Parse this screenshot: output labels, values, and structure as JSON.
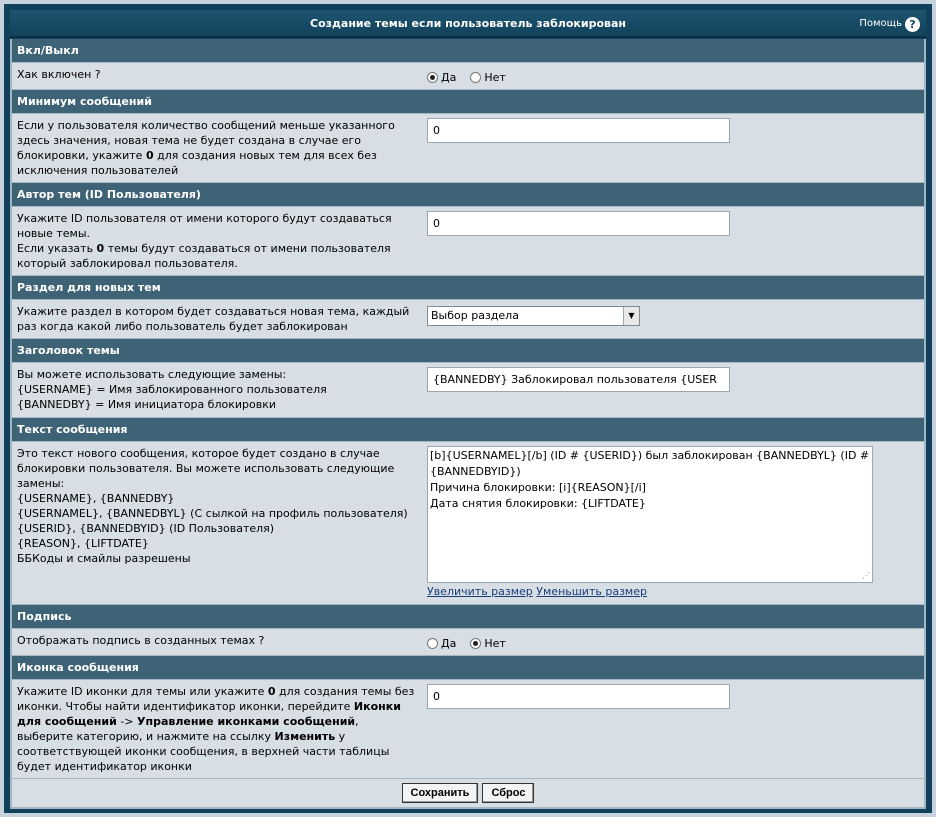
{
  "window": {
    "title": "Создание темы если пользователь заблокирован",
    "help_label": "Помощь",
    "help_icon": "?"
  },
  "sections": {
    "enable": {
      "header": "Вкл/Выкл",
      "label": "Хак включен ?",
      "options": [
        "Да",
        "Нет"
      ],
      "selected": "Да"
    },
    "min_posts": {
      "header": "Минимум сообщений",
      "label_a": "Если у пользователя количество сообщений меньше указанного здесь значения, новая тема не будет создана в случае его блокировки, укажите ",
      "label_b": "0",
      "label_c": " для создания новых тем для всех без исключения пользователей",
      "value": "0"
    },
    "author": {
      "header": "Автор тем (ID Пользователя)",
      "label_a": "Укажите ID пользователя от имени которого будут создаваться новые темы.",
      "label_b": "Если указать ",
      "label_c": "0",
      "label_d": " темы будут создаваться от имени пользователя который заблокировал пользователя.",
      "value": "0"
    },
    "forum": {
      "header": "Раздел для новых тем",
      "label": "Укажите раздел в котором будет создаваться новая тема, каждый раз когда какой либо пользователь будет заблокирован",
      "selected": "Выбор раздела"
    },
    "subject": {
      "header": "Заголовок темы",
      "label_a": "Вы можете использовать следующие замены:",
      "label_b": "{USERNAME} = Имя заблокированного пользователя",
      "label_c": "{BANNEDBY} = Имя инициатора блокировки",
      "value": "{BANNEDBY} Заблокировал пользователя {USER"
    },
    "message": {
      "header": "Текст сообщения",
      "label_lines": [
        "Это текст нового сообщения, которое будет создано в случае блокировки пользователя. Вы можете использовать следующие замены:",
        "{USERNAME}, {BANNEDBY}",
        "{USERNAMEL}, {BANNEDBYL} (С сылкой на профиль пользователя)",
        "{USERID}, {BANNEDBYID} (ID Пользователя)",
        "{REASON}, {LIFTDATE}",
        "ББКоды и смайлы разрешены"
      ],
      "value": "[b]{USERNAMEL}[/b] (ID # {USERID}) был заблокирован {BANNEDBYL} (ID # {BANNEDBYID})\nПричина блокировки: [i]{REASON}[/i]\nДата снятия блокировки: {LIFTDATE}",
      "enlarge_link": "Увеличить размер",
      "shrink_link": "Уменьшить размер"
    },
    "signature": {
      "header": "Подпись",
      "label": "Отображать подпись в созданных темах ?",
      "options": [
        "Да",
        "Нет"
      ],
      "selected": "Нет"
    },
    "icon": {
      "header": "Иконка сообщения",
      "label_a": "Укажите ID иконки для темы или укажите ",
      "label_b": "0",
      "label_c": " для создания темы без иконки. Чтобы найти идентификатор иконки, перейдите ",
      "label_d": "Иконки для сообщений",
      "label_e": " -> ",
      "label_f": "Управление иконками сообщений",
      "label_g": ", выберите категорию, и нажмите на ссылку ",
      "label_h": "Изменить",
      "label_i": " у соответствующей иконки сообщения, в верхней части таблицы будет идентификатор иконки",
      "value": "0"
    }
  },
  "footer": {
    "save_label": "Сохранить",
    "reset_label": "Сброс"
  }
}
